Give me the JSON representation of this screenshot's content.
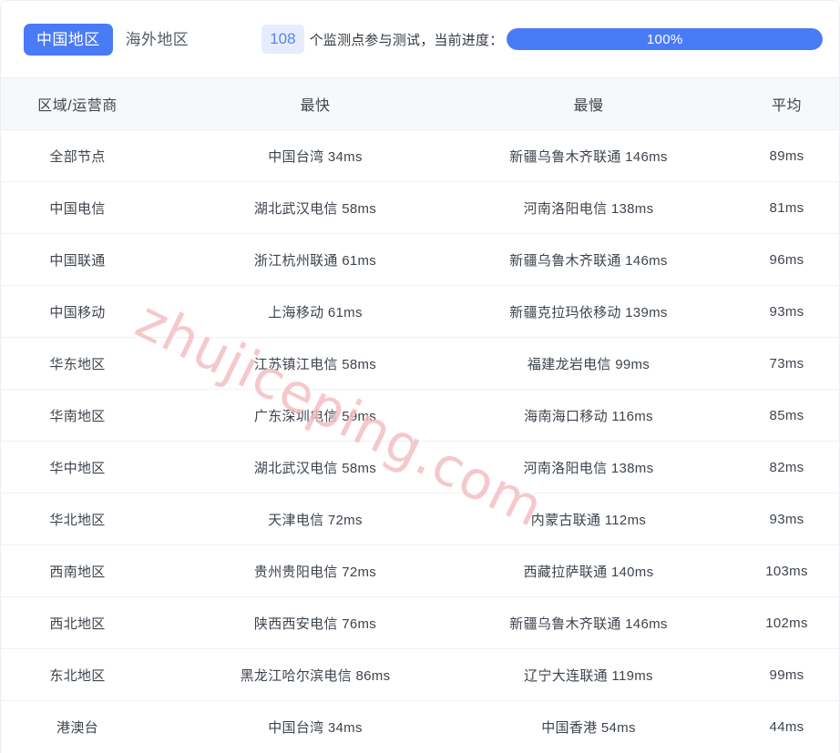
{
  "header": {
    "tabs": [
      {
        "label": "中国地区",
        "active": true
      },
      {
        "label": "海外地区",
        "active": false
      }
    ],
    "node_count": "108",
    "status_text": "个监测点参与测试，当前进度：",
    "progress_label": "100%",
    "progress_percent": 100,
    "accent_color": "#4a7bf7",
    "badge_bg_color": "#e6ecfd",
    "badge_text_color": "#5b84f0"
  },
  "table": {
    "columns": [
      "区域/运营商",
      "最快",
      "最慢",
      "平均"
    ],
    "rows": [
      {
        "region": "全部节点",
        "fastest": "中国台湾 34ms",
        "slowest": "新疆乌鲁木齐联通 146ms",
        "average": "89ms"
      },
      {
        "region": "中国电信",
        "fastest": "湖北武汉电信 58ms",
        "slowest": "河南洛阳电信 138ms",
        "average": "81ms"
      },
      {
        "region": "中国联通",
        "fastest": "浙江杭州联通 61ms",
        "slowest": "新疆乌鲁木齐联通 146ms",
        "average": "96ms"
      },
      {
        "region": "中国移动",
        "fastest": "上海移动 61ms",
        "slowest": "新疆克拉玛依移动 139ms",
        "average": "93ms"
      },
      {
        "region": "华东地区",
        "fastest": "江苏镇江电信 58ms",
        "slowest": "福建龙岩电信 99ms",
        "average": "73ms"
      },
      {
        "region": "华南地区",
        "fastest": "广东深圳电信 59ms",
        "slowest": "海南海口移动 116ms",
        "average": "85ms"
      },
      {
        "region": "华中地区",
        "fastest": "湖北武汉电信 58ms",
        "slowest": "河南洛阳电信 138ms",
        "average": "82ms"
      },
      {
        "region": "华北地区",
        "fastest": "天津电信 72ms",
        "slowest": "内蒙古联通 112ms",
        "average": "93ms"
      },
      {
        "region": "西南地区",
        "fastest": "贵州贵阳电信 72ms",
        "slowest": "西藏拉萨联通 140ms",
        "average": "103ms"
      },
      {
        "region": "西北地区",
        "fastest": "陕西西安电信 76ms",
        "slowest": "新疆乌鲁木齐联通 146ms",
        "average": "102ms"
      },
      {
        "region": "东北地区",
        "fastest": "黑龙江哈尔滨电信 86ms",
        "slowest": "辽宁大连联通 119ms",
        "average": "99ms"
      },
      {
        "region": "港澳台",
        "fastest": "中国台湾 34ms",
        "slowest": "中国香港 54ms",
        "average": "44ms"
      }
    ]
  },
  "watermark": {
    "text": "zhujiceping.com",
    "color": "#f4bfc2"
  }
}
